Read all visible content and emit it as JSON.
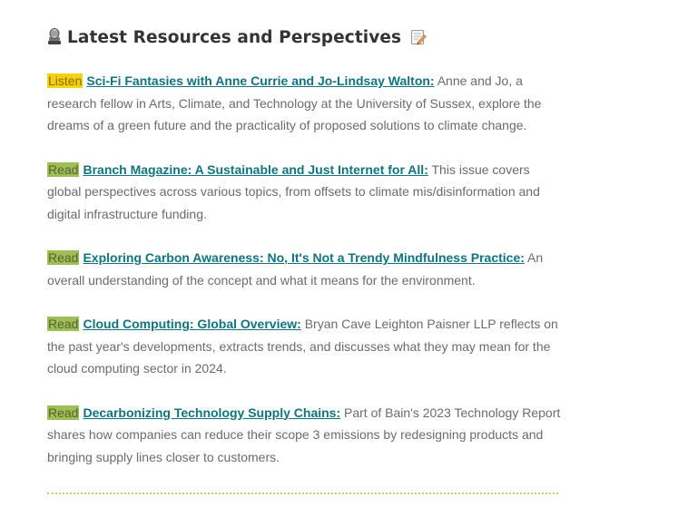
{
  "heading": {
    "title": "Latest Resources and Perspectives",
    "left_icon": "microphone-icon",
    "right_icon": "memo-icon"
  },
  "items": [
    {
      "tag": "Listen",
      "tag_color": "#f5d10f",
      "title": "Sci-Fi Fantasies with Anne Currie and Jo-Lindsay Walton:",
      "description": "Anne and Jo, a research fellow in Arts, Climate, and Technology at the University of Sussex, explore the dreams of a green future and the practicality of proposed solutions to climate change."
    },
    {
      "tag": "Read",
      "tag_color": "#9fbd59",
      "title": "Branch Magazine: A Sustainable and Just Internet for All:",
      "description": "This issue covers global perspectives across various topics, from offsets to climate mis/disinformation and digital infrastructure funding."
    },
    {
      "tag": "Read",
      "tag_color": "#9fbd59",
      "title": "Exploring Carbon Awareness: No, It's Not a Trendy Mindfulness Practice:",
      "description": "An overall understanding of the concept and what it means for the environment."
    },
    {
      "tag": "Read",
      "tag_color": "#9fbd59",
      "title": "Cloud Computing: Global Overview:",
      "description": "Bryan Cave Leighton Paisner LLP reflects on the past year's developments, extracts trends, and discusses what they may mean for the cloud computing sector in 2024."
    },
    {
      "tag": "Read",
      "tag_color": "#9fbd59",
      "title": "Decarbonizing Technology Supply Chains:",
      "description": "Part of Bain's 2023 Technology Report shares how companies can reduce their scope 3 emissions by  redesigning products and bringing supply lines closer to customers."
    }
  ],
  "colors": {
    "link": "#0f7480",
    "body_text": "#6b6b6b",
    "heading": "#333333",
    "divider": "#c9d468"
  }
}
